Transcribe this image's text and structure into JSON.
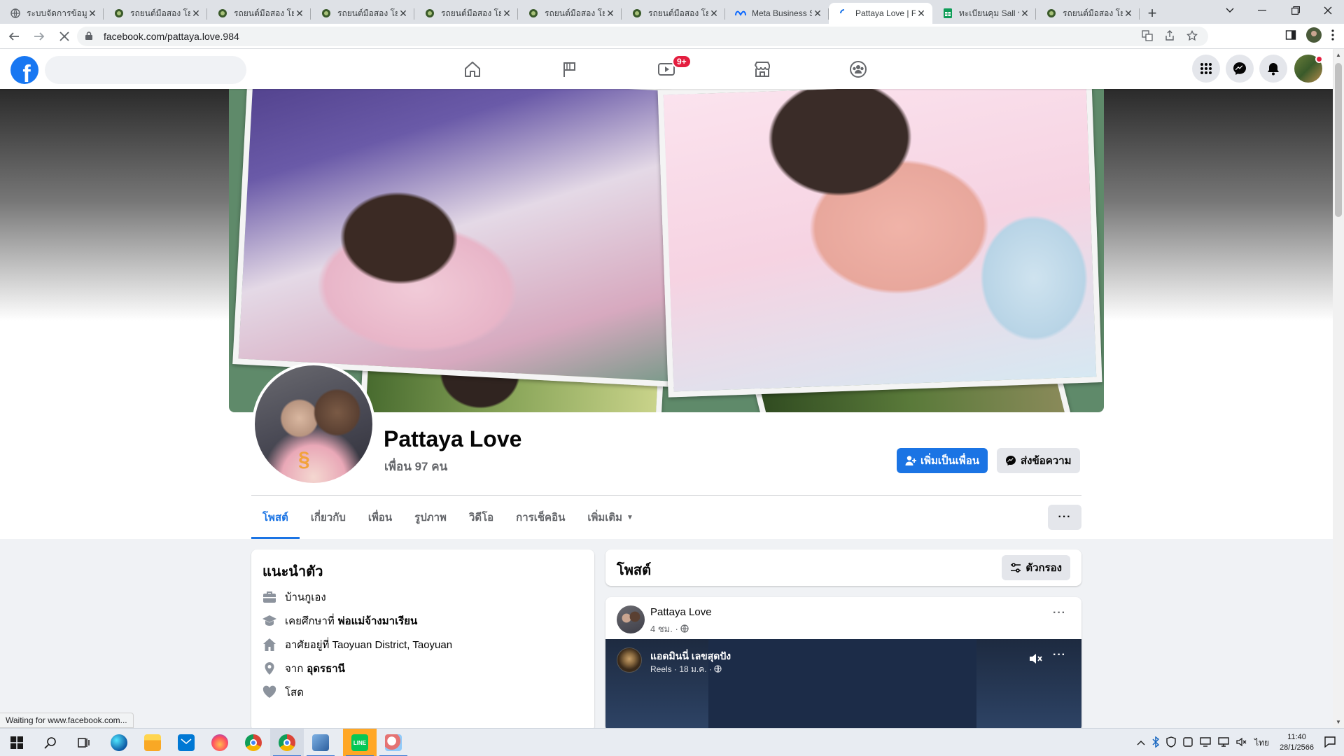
{
  "browser": {
    "tabs": [
      {
        "title": "ระบบจัดการข้อมูล",
        "active": false
      },
      {
        "title": "รถยนต์มือสอง โยฯ",
        "active": false
      },
      {
        "title": "รถยนต์มือสอง โยฯ",
        "active": false
      },
      {
        "title": "รถยนต์มือสอง โยฯ",
        "active": false
      },
      {
        "title": "รถยนต์มือสอง โยฯ",
        "active": false
      },
      {
        "title": "รถยนต์มือสอง โยฯ",
        "active": false
      },
      {
        "title": "รถยนต์มือสอง โยฯ",
        "active": false
      },
      {
        "title": "Meta Business S",
        "active": false
      },
      {
        "title": "Pattaya Love | F",
        "active": true
      },
      {
        "title": "ทะเบียนคุม Sall ระ",
        "active": false
      },
      {
        "title": "รถยนต์มือสอง โยฯ",
        "active": false
      }
    ],
    "new_tab": "+",
    "url": "facebook.com/pattaya.love.984",
    "status_text": "Waiting for www.facebook.com..."
  },
  "facebook": {
    "logo": "f",
    "search_placeholder": "",
    "notif_badge": "9+"
  },
  "profile": {
    "name": "Pattaya Love",
    "friends": "เพื่อน 97 คน",
    "add_friend_label": "เพิ่มเป็นเพื่อน",
    "message_label": "ส่งข้อความ",
    "tabs": [
      {
        "label": "โพสต์",
        "active": true
      },
      {
        "label": "เกี่ยวกับ",
        "active": false
      },
      {
        "label": "เพื่อน",
        "active": false
      },
      {
        "label": "รูปภาพ",
        "active": false
      },
      {
        "label": "วิดีโอ",
        "active": false
      },
      {
        "label": "การเช็คอิน",
        "active": false
      },
      {
        "label": "เพิ่มเติม",
        "active": false
      }
    ],
    "more_dots": "···"
  },
  "intro": {
    "title": "แนะนำตัว",
    "items": [
      {
        "icon": "briefcase-icon",
        "text": "บ้านกูเอง",
        "bold": ""
      },
      {
        "icon": "graduation-cap-icon",
        "text": "เคยศึกษาที่",
        "bold": "พ่อแม่จ้างมาเรียน"
      },
      {
        "icon": "home-icon",
        "text": "อาศัยอยู่ที่ Taoyuan District, Taoyuan",
        "bold": ""
      },
      {
        "icon": "location-pin-icon",
        "text": "จาก",
        "bold": "อุดรธานี"
      },
      {
        "icon": "heart-icon",
        "text": "โสด",
        "bold": ""
      }
    ]
  },
  "posts": {
    "title": "โพสต์",
    "filter_label": "ตัวกรอง",
    "post": {
      "author": "Pattaya Love",
      "meta": "4 ชม. · ",
      "dots": "···",
      "reel_title": "แอดมินนี่ เลขสุดปัง",
      "reel_meta": "Reels · 18 ม.ค. · "
    }
  },
  "taskbar": {
    "lang": "ไทย",
    "time": "11:40",
    "date": "28/1/2566"
  },
  "colors": {
    "fb_blue": "#1877f2",
    "link_blue": "#1b74e4",
    "badge_red": "#e41e3f"
  }
}
